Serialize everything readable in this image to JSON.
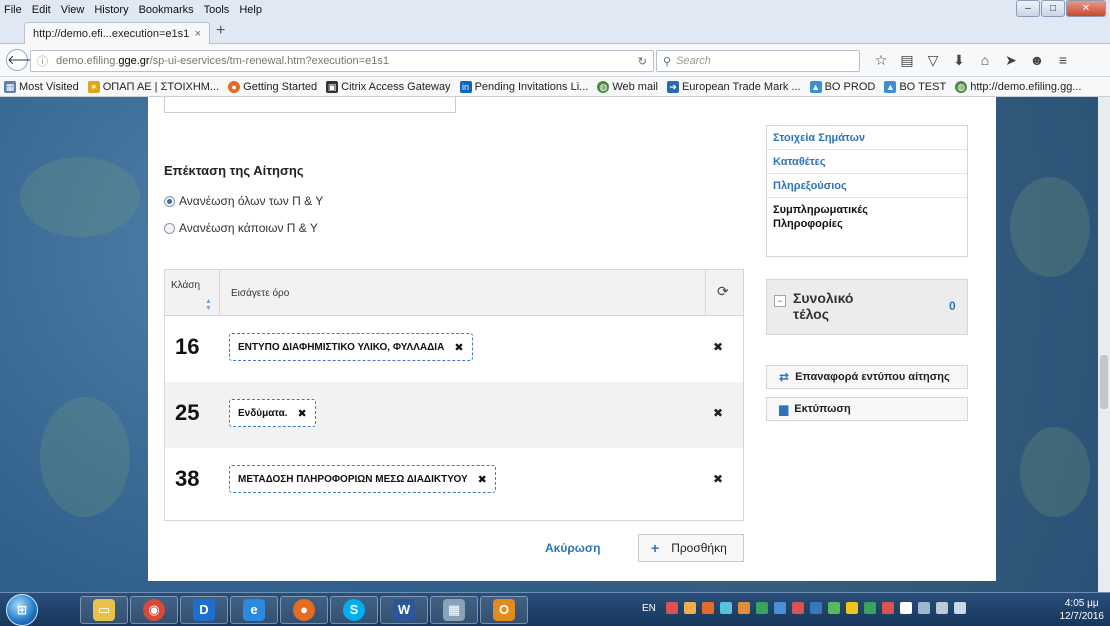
{
  "menu": [
    "File",
    "Edit",
    "View",
    "History",
    "Bookmarks",
    "Tools",
    "Help"
  ],
  "menu_keys": [
    "F",
    "E",
    "V",
    "s",
    "B",
    "T",
    "H"
  ],
  "tab": {
    "title": "http://demo.efi...execution=e1s1",
    "close": "×",
    "new": "+"
  },
  "url": {
    "prefix": "demo.efiling.",
    "domain": "gge.gr",
    "path": "/sp-ui-eservices/tm-renewal.htm?execution=e1s1"
  },
  "search": {
    "placeholder": "Search"
  },
  "bookmarks": [
    {
      "label": "Most Visited",
      "color": "#5a7fb0"
    },
    {
      "label": "ΟΠΑΠ ΑΕ | ΣΤΟΙΧΗΜ...",
      "color": "#e0a51b"
    },
    {
      "label": "Getting Started",
      "color": "#e66a1f"
    },
    {
      "label": "Citrix Access Gateway",
      "color": "#333333"
    },
    {
      "label": "Pending Invitations Li...",
      "color": "#0a66c2"
    },
    {
      "label": "Web mail",
      "color": "#4b8b3b"
    },
    {
      "label": "European Trade Mark ...",
      "color": "#2a6ab0"
    },
    {
      "label": "BO PROD",
      "color": "#3d8ed6"
    },
    {
      "label": "BO TEST",
      "color": "#3d8ed6"
    },
    {
      "label": "http://demo.efiling.gg...",
      "color": "#4b8b3b"
    }
  ],
  "form": {
    "section_title": "Επέκταση της Αίτησης",
    "radio_all": "Ανανέωση όλων των Π & Υ",
    "radio_some": "Ανανέωση κάποιων Π & Υ",
    "col_class": "Κλάση",
    "col_term": "Εισάγετε όρο",
    "rows": [
      {
        "num": "16",
        "term": "ΕΝΤΥΠΟ ΔΙΑΦΗΜΙΣΤΙΚΟ ΥΛΙΚΟ, ΦΥΛΛΑΔΙΑ"
      },
      {
        "num": "25",
        "term": "Ενδύματα."
      },
      {
        "num": "38",
        "term": "ΜΕΤΑΔΟΣΗ ΠΛΗΡΟΦΟΡΙΩΝ ΜΕΣΩ ΔΙΑΔΙΚΤΥΟΥ"
      }
    ],
    "cancel": "Ακύρωση",
    "add": "Προσθήκη"
  },
  "sidebar": {
    "items": [
      "Στοιχεία Σημάτων",
      "Καταθέτες",
      "Πληρεξούσιος"
    ],
    "active_1": "Συμπληρωματικές",
    "active_2": "Πληροφορίες",
    "fee_label": "Συνολικό τέλος",
    "fee_amount": "0",
    "reset": "Επαναφορά εντύπου αίτησης",
    "print": "Εκτύπωση"
  },
  "taskbar": {
    "lang": "EN",
    "time": "4:05 μμ",
    "date": "12/7/2016"
  },
  "colors": {
    "accent": "#2d73b9",
    "chip_border": "#3d7bc6"
  }
}
